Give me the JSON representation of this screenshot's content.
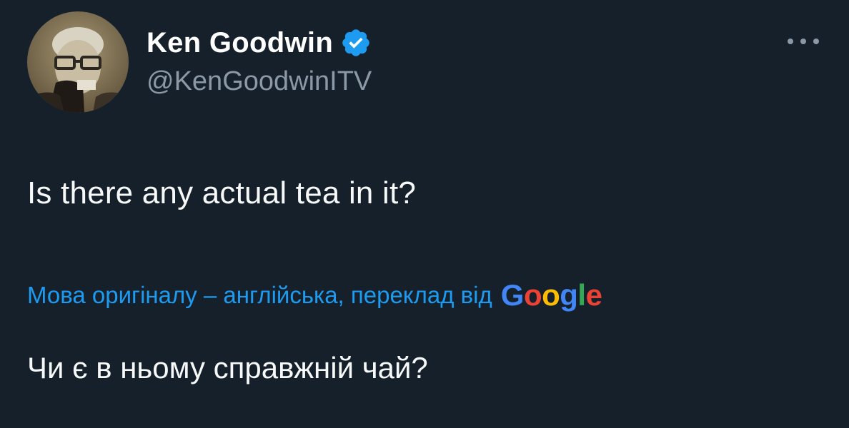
{
  "author": {
    "display_name": "Ken Goodwin",
    "handle": "@KenGoodwinITV",
    "verified": true,
    "verified_icon": "verified-badge-icon",
    "avatar_icon": "profile-photo"
  },
  "tweet": {
    "text": "Is there any actual tea in it?",
    "more_icon": "more-options-icon"
  },
  "translation": {
    "notice": "Мова оригіналу – англійська, переклад від",
    "provider_letters": [
      "G",
      "o",
      "o",
      "g",
      "l",
      "e"
    ],
    "translated_text": "Чи є в ньому справжній чай?"
  },
  "colors": {
    "background": "#15202b",
    "text_primary": "#f7f9f9",
    "text_secondary": "#8b98a5",
    "accent": "#1d9bf0",
    "google_blue": "#4285f4",
    "google_red": "#ea4335",
    "google_yellow": "#fbbc05",
    "google_green": "#34a853"
  }
}
